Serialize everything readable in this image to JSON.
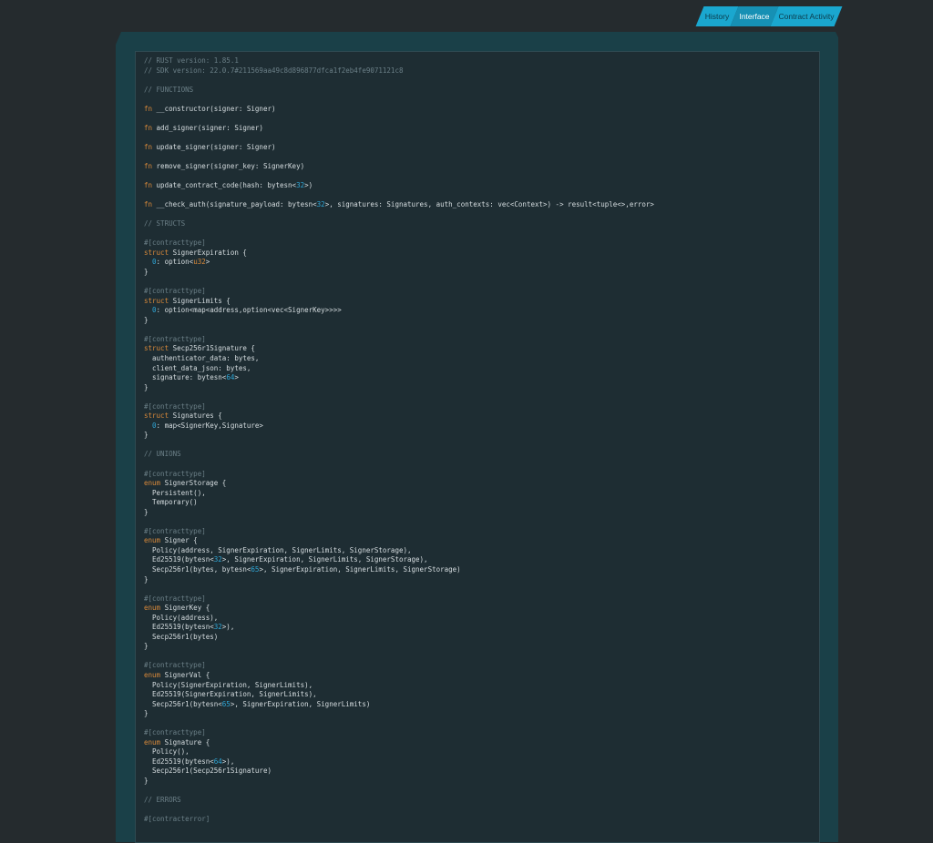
{
  "tabs": [
    {
      "label": "History",
      "active": false
    },
    {
      "label": "Interface",
      "active": true
    },
    {
      "label": "Contract Activity",
      "active": false
    }
  ],
  "code_lines": [
    [
      {
        "t": "// RUST version: 1.85.1",
        "c": "comment"
      }
    ],
    [
      {
        "t": "// SDK version: 22.0.7#211569aa49c8d896877dfca1f2eb4fe9071121c8",
        "c": "comment"
      }
    ],
    [],
    [
      {
        "t": "// FUNCTIONS",
        "c": "comment"
      }
    ],
    [],
    [
      {
        "t": "fn",
        "c": "kw"
      },
      {
        "t": " __constructor(signer: Signer)"
      }
    ],
    [],
    [
      {
        "t": "fn",
        "c": "kw"
      },
      {
        "t": " add_signer(signer: Signer)"
      }
    ],
    [],
    [
      {
        "t": "fn",
        "c": "kw"
      },
      {
        "t": " update_signer(signer: Signer)"
      }
    ],
    [],
    [
      {
        "t": "fn",
        "c": "kw"
      },
      {
        "t": " remove_signer(signer_key: SignerKey)"
      }
    ],
    [],
    [
      {
        "t": "fn",
        "c": "kw"
      },
      {
        "t": " update_contract_code(hash: bytesn<"
      },
      {
        "t": "32",
        "c": "num"
      },
      {
        "t": ">)"
      }
    ],
    [],
    [
      {
        "t": "fn",
        "c": "kw"
      },
      {
        "t": " __check_auth(signature_payload: bytesn<"
      },
      {
        "t": "32",
        "c": "num"
      },
      {
        "t": ">, signatures: Signatures, auth_contexts: vec<Context>) -> result<tuple<>,error>"
      }
    ],
    [],
    [
      {
        "t": "// STRUCTS",
        "c": "comment"
      }
    ],
    [],
    [
      {
        "t": "#[contracttype]",
        "c": "attr"
      }
    ],
    [
      {
        "t": "struct",
        "c": "kw"
      },
      {
        "t": " SignerExpiration {"
      }
    ],
    [
      {
        "t": "  "
      },
      {
        "t": "0",
        "c": "num"
      },
      {
        "t": ": option<"
      },
      {
        "t": "u32",
        "c": "kw"
      },
      {
        "t": ">"
      }
    ],
    [
      {
        "t": "}"
      }
    ],
    [],
    [
      {
        "t": "#[contracttype]",
        "c": "attr"
      }
    ],
    [
      {
        "t": "struct",
        "c": "kw"
      },
      {
        "t": " SignerLimits {"
      }
    ],
    [
      {
        "t": "  "
      },
      {
        "t": "0",
        "c": "num"
      },
      {
        "t": ": option<map<address,option<vec<SignerKey>>>>"
      }
    ],
    [
      {
        "t": "}"
      }
    ],
    [],
    [
      {
        "t": "#[contracttype]",
        "c": "attr"
      }
    ],
    [
      {
        "t": "struct",
        "c": "kw"
      },
      {
        "t": " Secp256r1Signature {"
      }
    ],
    [
      {
        "t": "  authenticator_data: bytes,"
      }
    ],
    [
      {
        "t": "  client_data_json: bytes,"
      }
    ],
    [
      {
        "t": "  signature: bytesn<"
      },
      {
        "t": "64",
        "c": "num"
      },
      {
        "t": ">"
      }
    ],
    [
      {
        "t": "}"
      }
    ],
    [],
    [
      {
        "t": "#[contracttype]",
        "c": "attr"
      }
    ],
    [
      {
        "t": "struct",
        "c": "kw"
      },
      {
        "t": " Signatures {"
      }
    ],
    [
      {
        "t": "  "
      },
      {
        "t": "0",
        "c": "num"
      },
      {
        "t": ": map<SignerKey,Signature>"
      }
    ],
    [
      {
        "t": "}"
      }
    ],
    [],
    [
      {
        "t": "// UNIONS",
        "c": "comment"
      }
    ],
    [],
    [
      {
        "t": "#[contracttype]",
        "c": "attr"
      }
    ],
    [
      {
        "t": "enum",
        "c": "kw"
      },
      {
        "t": " SignerStorage {"
      }
    ],
    [
      {
        "t": "  Persistent(),"
      }
    ],
    [
      {
        "t": "  Temporary()"
      }
    ],
    [
      {
        "t": "}"
      }
    ],
    [],
    [
      {
        "t": "#[contracttype]",
        "c": "attr"
      }
    ],
    [
      {
        "t": "enum",
        "c": "kw"
      },
      {
        "t": " Signer {"
      }
    ],
    [
      {
        "t": "  Policy(address, SignerExpiration, SignerLimits, SignerStorage),"
      }
    ],
    [
      {
        "t": "  Ed25519(bytesn<"
      },
      {
        "t": "32",
        "c": "num"
      },
      {
        "t": ">, SignerExpiration, SignerLimits, SignerStorage),"
      }
    ],
    [
      {
        "t": "  Secp256r1(bytes, bytesn<"
      },
      {
        "t": "65",
        "c": "num"
      },
      {
        "t": ">, SignerExpiration, SignerLimits, SignerStorage)"
      }
    ],
    [
      {
        "t": "}"
      }
    ],
    [],
    [
      {
        "t": "#[contracttype]",
        "c": "attr"
      }
    ],
    [
      {
        "t": "enum",
        "c": "kw"
      },
      {
        "t": " SignerKey {"
      }
    ],
    [
      {
        "t": "  Policy(address),"
      }
    ],
    [
      {
        "t": "  Ed25519(bytesn<"
      },
      {
        "t": "32",
        "c": "num"
      },
      {
        "t": ">),"
      }
    ],
    [
      {
        "t": "  Secp256r1(bytes)"
      }
    ],
    [
      {
        "t": "}"
      }
    ],
    [],
    [
      {
        "t": "#[contracttype]",
        "c": "attr"
      }
    ],
    [
      {
        "t": "enum",
        "c": "kw"
      },
      {
        "t": " SignerVal {"
      }
    ],
    [
      {
        "t": "  Policy(SignerExpiration, SignerLimits),"
      }
    ],
    [
      {
        "t": "  Ed25519(SignerExpiration, SignerLimits),"
      }
    ],
    [
      {
        "t": "  Secp256r1(bytesn<"
      },
      {
        "t": "65",
        "c": "num"
      },
      {
        "t": ">, SignerExpiration, SignerLimits)"
      }
    ],
    [
      {
        "t": "}"
      }
    ],
    [],
    [
      {
        "t": "#[contracttype]",
        "c": "attr"
      }
    ],
    [
      {
        "t": "enum",
        "c": "kw"
      },
      {
        "t": " Signature {"
      }
    ],
    [
      {
        "t": "  Policy(),"
      }
    ],
    [
      {
        "t": "  Ed25519(bytesn<"
      },
      {
        "t": "64",
        "c": "num"
      },
      {
        "t": ">),"
      }
    ],
    [
      {
        "t": "  Secp256r1(Secp256r1Signature)"
      }
    ],
    [
      {
        "t": "}"
      }
    ],
    [],
    [
      {
        "t": "// ERRORS",
        "c": "comment"
      }
    ],
    [],
    [
      {
        "t": "#[contracterror]",
        "c": "attr"
      }
    ]
  ]
}
